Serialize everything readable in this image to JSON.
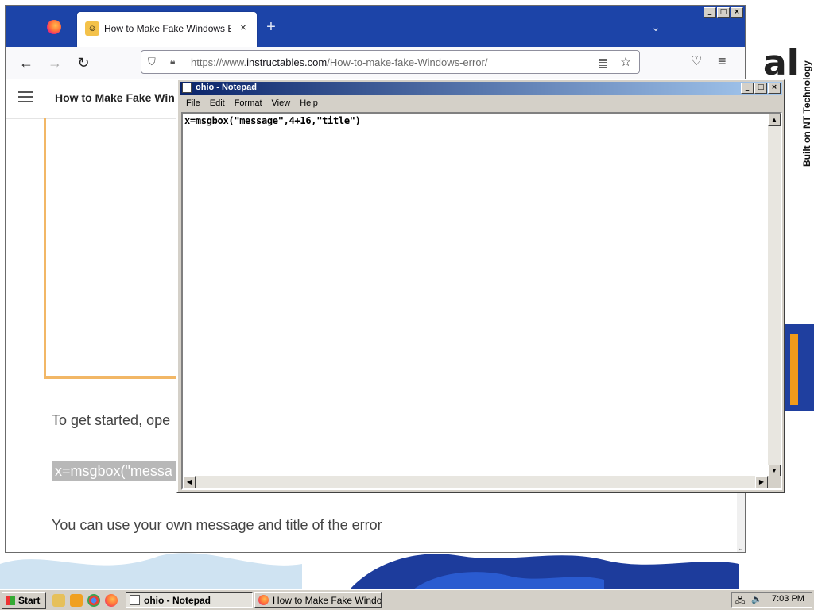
{
  "desktop": {
    "brand_logo": "al",
    "brand_tagline": "Built on NT Technology"
  },
  "firefox": {
    "tab": {
      "title": "How to Make Fake Windows Error :",
      "close": "×"
    },
    "new_tab": "+",
    "tab_list": "⌄",
    "url": {
      "prefix": "https://www.",
      "domain": "instructables.com",
      "path": "/How-to-make-fake-Windows-error/"
    },
    "page": {
      "site_title": "How to Make Fake Win",
      "para_1": "To get started, ope",
      "code": "x=msgbox(\"messa",
      "para_2": "You can use your own message and title of the error"
    }
  },
  "notepad": {
    "title": "ohio - Notepad",
    "menu": [
      "File",
      "Edit",
      "Format",
      "View",
      "Help"
    ],
    "content": "x=msgbox(\"message\",4+16,\"title\")"
  },
  "taskbar": {
    "start": "Start",
    "tasks": [
      {
        "label": "ohio - Notepad",
        "active": true
      },
      {
        "label": "How to Make Fake Windo...",
        "active": false
      }
    ],
    "clock": "7:03 PM"
  }
}
